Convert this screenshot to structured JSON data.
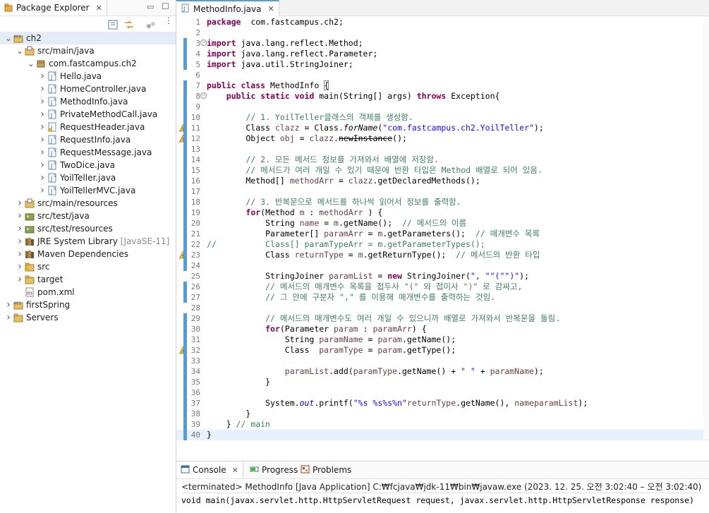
{
  "explorer": {
    "tab_label": "Package Explorer",
    "tree": [
      {
        "label": "ch2",
        "indent": 0,
        "twisty": "open",
        "icon": "maven-project-icon"
      },
      {
        "label": "src/main/java",
        "indent": 1,
        "twisty": "open",
        "icon": "source-folder-icon"
      },
      {
        "label": "com.fastcampus.ch2",
        "indent": 2,
        "twisty": "open",
        "icon": "package-icon"
      },
      {
        "label": "Hello.java",
        "indent": 3,
        "twisty": "closed",
        "icon": "java-file-icon"
      },
      {
        "label": "HomeController.java",
        "indent": 3,
        "twisty": "closed",
        "icon": "java-file-icon"
      },
      {
        "label": "MethodInfo.java",
        "indent": 3,
        "twisty": "closed",
        "icon": "java-file-icon"
      },
      {
        "label": "PrivateMethodCall.java",
        "indent": 3,
        "twisty": "closed",
        "icon": "java-file-icon"
      },
      {
        "label": "RequestHeader.java",
        "indent": 3,
        "twisty": "closed",
        "icon": "java-file-warn-icon"
      },
      {
        "label": "RequestInfo.java",
        "indent": 3,
        "twisty": "closed",
        "icon": "java-file-icon"
      },
      {
        "label": "RequestMessage.java",
        "indent": 3,
        "twisty": "closed",
        "icon": "java-file-icon"
      },
      {
        "label": "TwoDice.java",
        "indent": 3,
        "twisty": "closed",
        "icon": "java-file-icon"
      },
      {
        "label": "YoilTeller.java",
        "indent": 3,
        "twisty": "closed",
        "icon": "java-file-icon"
      },
      {
        "label": "YoilTellerMVC.java",
        "indent": 3,
        "twisty": "closed",
        "icon": "java-file-icon"
      },
      {
        "label": "src/main/resources",
        "indent": 1,
        "twisty": "closed",
        "icon": "source-folder-icon"
      },
      {
        "label": "src/test/java",
        "indent": 1,
        "twisty": "closed",
        "icon": "test-folder-icon"
      },
      {
        "label": "src/test/resources",
        "indent": 1,
        "twisty": "closed",
        "icon": "test-folder-icon"
      },
      {
        "label": "JRE System Library",
        "decoration": "[JavaSE-11]",
        "indent": 1,
        "twisty": "closed",
        "icon": "library-icon"
      },
      {
        "label": "Maven Dependencies",
        "indent": 1,
        "twisty": "closed",
        "icon": "library-icon"
      },
      {
        "label": "src",
        "indent": 1,
        "twisty": "closed",
        "icon": "folder-warn-icon"
      },
      {
        "label": "target",
        "indent": 1,
        "twisty": "closed",
        "icon": "folder-icon"
      },
      {
        "label": "pom.xml",
        "indent": 1,
        "twisty": "none",
        "icon": "maven-file-icon"
      },
      {
        "label": "firstSpring",
        "indent": 0,
        "twisty": "closed",
        "icon": "maven-project-icon"
      },
      {
        "label": "Servers",
        "indent": 0,
        "twisty": "closed",
        "icon": "folder-icon"
      }
    ]
  },
  "editor": {
    "tab_label": "MethodInfo.java",
    "lines": [
      {
        "n": "1",
        "tokens": [
          [
            "kw",
            "package"
          ],
          [
            "",
            "  com.fastcampus.ch2;"
          ]
        ]
      },
      {
        "n": "2",
        "tokens": []
      },
      {
        "n": "3",
        "fold": true,
        "tokens": [
          [
            "kw",
            "import"
          ],
          [
            "",
            " java.lang.reflect.Method;"
          ]
        ]
      },
      {
        "n": "4",
        "tokens": [
          [
            "kw",
            "import"
          ],
          [
            "",
            " java.lang.reflect.Parameter;"
          ]
        ]
      },
      {
        "n": "5",
        "tokens": [
          [
            "kw",
            "import"
          ],
          [
            "",
            " java.util.StringJoiner;"
          ]
        ]
      },
      {
        "n": "6",
        "tokens": []
      },
      {
        "n": "7",
        "tokens": [
          [
            "kw",
            "public class"
          ],
          [
            "",
            " MethodInfo "
          ],
          [
            "",
            "{"
          ]
        ]
      },
      {
        "n": "8",
        "fold": true,
        "tokens": [
          [
            "",
            "    "
          ],
          [
            "kw",
            "public static void"
          ],
          [
            "",
            " main(String[] args) "
          ],
          [
            "kw",
            "throws"
          ],
          [
            "",
            " Exception{"
          ]
        ]
      },
      {
        "n": "9",
        "tokens": []
      },
      {
        "n": "10",
        "tokens": [
          [
            "",
            "        "
          ],
          [
            "cmt",
            "// 1. YoilTeller클래스의 객체를 생성함."
          ]
        ]
      },
      {
        "n": "11",
        "warn": true,
        "tokens": [
          [
            "",
            "        Class "
          ],
          [
            "var",
            "clazz"
          ],
          [
            "",
            " = Class."
          ],
          [
            "it",
            "forName"
          ],
          [
            "",
            "("
          ],
          [
            "str",
            "\"com.fastcampus.ch2.YoilTeller\""
          ],
          [
            "",
            ");"
          ]
        ]
      },
      {
        "n": "12",
        "warn": true,
        "tokens": [
          [
            "",
            "        Object "
          ],
          [
            "var",
            "obj"
          ],
          [
            "",
            " = "
          ],
          [
            "var",
            "clazz"
          ],
          [
            "",
            "."
          ],
          [
            "strike",
            "newInstance"
          ],
          [
            "",
            "();"
          ]
        ]
      },
      {
        "n": "13",
        "tokens": []
      },
      {
        "n": "14",
        "tokens": [
          [
            "",
            "        "
          ],
          [
            "cmt",
            "// 2. 모든 메서드 정보를 가져와서 배열에 저장함."
          ]
        ]
      },
      {
        "n": "15",
        "tokens": [
          [
            "",
            "        "
          ],
          [
            "cmt",
            "// 메서드가 여러 개일 수 있기 때문에 반환 타입은 Method 배열로 되어 있음."
          ]
        ]
      },
      {
        "n": "16",
        "tokens": [
          [
            "",
            "        Method[] "
          ],
          [
            "var",
            "methodArr"
          ],
          [
            "",
            " = "
          ],
          [
            "var",
            "clazz"
          ],
          [
            "",
            ".getDeclaredMethods();"
          ]
        ]
      },
      {
        "n": "17",
        "tokens": []
      },
      {
        "n": "18",
        "tokens": [
          [
            "",
            "        "
          ],
          [
            "cmt",
            "// 3. 반복문으로 메서드를 하나씩 읽어서 정보를 출력함."
          ]
        ]
      },
      {
        "n": "19",
        "tokens": [
          [
            "",
            "        "
          ],
          [
            "kw",
            "for"
          ],
          [
            "",
            "(Method "
          ],
          [
            "var",
            "m"
          ],
          [
            "",
            " : "
          ],
          [
            "var",
            "methodArr"
          ],
          [
            "",
            " ) {"
          ]
        ]
      },
      {
        "n": "20",
        "tokens": [
          [
            "",
            "            String "
          ],
          [
            "var",
            "name"
          ],
          [
            "",
            " = "
          ],
          [
            "var",
            "m"
          ],
          [
            "",
            ".getName();  "
          ],
          [
            "cmt",
            "// 메서드의 이름"
          ]
        ]
      },
      {
        "n": "21",
        "tokens": [
          [
            "",
            "            Parameter[] "
          ],
          [
            "var",
            "paramArr"
          ],
          [
            "",
            " = "
          ],
          [
            "var",
            "m"
          ],
          [
            "",
            ".getParameters();  "
          ],
          [
            "cmt",
            "// 매개변수 목록"
          ]
        ]
      },
      {
        "n": "22",
        "tokens": [
          [
            "cmt",
            "//          Class[] paramTypeArr = m.getParameterTypes();"
          ]
        ]
      },
      {
        "n": "23",
        "warn": true,
        "tokens": [
          [
            "",
            "            Class "
          ],
          [
            "var",
            "returnType"
          ],
          [
            "",
            " = "
          ],
          [
            "var",
            "m"
          ],
          [
            "",
            ".getReturnType();  "
          ],
          [
            "cmt",
            "// 메서드의 반환 타입"
          ]
        ]
      },
      {
        "n": "24",
        "tokens": []
      },
      {
        "n": "25",
        "tokens": [
          [
            "",
            "            StringJoiner "
          ],
          [
            "var",
            "paramList"
          ],
          [
            "",
            " = "
          ],
          [
            "kw",
            "new"
          ],
          [
            "",
            " StringJoiner("
          ],
          [
            "str",
            "\", \""
          ],
          [
            ", "
          ],
          [
            "str",
            "\"(\""
          ],
          [
            ", "
          ],
          [
            "str",
            "\")\""
          ],
          [
            "",
            ");"
          ]
        ]
      },
      {
        "n": "26",
        "tokens": [
          [
            "",
            "            "
          ],
          [
            "cmt",
            "// 메서드의 매개변수 목록을 접두사 \"(\" 와 접미사 \")\" 로 감싸고,"
          ]
        ]
      },
      {
        "n": "27",
        "tokens": [
          [
            "",
            "            "
          ],
          [
            "cmt",
            "// 그 안에 구분자 \",\" 를 이용해 매개변수를 출력하는 것임."
          ]
        ]
      },
      {
        "n": "28",
        "tokens": []
      },
      {
        "n": "29",
        "tokens": [
          [
            "",
            "            "
          ],
          [
            "cmt",
            "// 메서드의 매개변수도 여러 개일 수 있으니까 배열로 가져와서 반복문을 돌림."
          ]
        ]
      },
      {
        "n": "30",
        "tokens": [
          [
            "",
            "            "
          ],
          [
            "kw",
            "for"
          ],
          [
            "",
            "(Parameter "
          ],
          [
            "var",
            "param"
          ],
          [
            "",
            " : "
          ],
          [
            "var",
            "paramArr"
          ],
          [
            "",
            ") {"
          ]
        ]
      },
      {
        "n": "31",
        "tokens": [
          [
            "",
            "                String "
          ],
          [
            "var",
            "paramName"
          ],
          [
            "",
            " = "
          ],
          [
            "var",
            "param"
          ],
          [
            "",
            ".getName();"
          ]
        ]
      },
      {
        "n": "32",
        "warn": true,
        "tokens": [
          [
            "",
            "                Class  "
          ],
          [
            "var",
            "paramType"
          ],
          [
            "",
            " = "
          ],
          [
            "var",
            "param"
          ],
          [
            "",
            ".getType();"
          ]
        ]
      },
      {
        "n": "33",
        "tokens": []
      },
      {
        "n": "34",
        "tokens": [
          [
            "",
            "                "
          ],
          [
            "var",
            "paramList"
          ],
          [
            "",
            ".add("
          ],
          [
            "var",
            "paramType"
          ],
          [
            "",
            ".getName() + "
          ],
          [
            "str",
            "\" \""
          ],
          [
            "",
            " + "
          ],
          [
            "var",
            "paramName"
          ],
          [
            "",
            ");"
          ]
        ]
      },
      {
        "n": "35",
        "tokens": [
          [
            "",
            "            }"
          ]
        ]
      },
      {
        "n": "36",
        "tokens": []
      },
      {
        "n": "37",
        "tokens": [
          [
            "",
            "            System."
          ],
          [
            "fld",
            "out"
          ],
          [
            "",
            ".printf("
          ],
          [
            "str",
            "\"%s %s%s%n\""
          ],
          [
            ", "
          ],
          [
            "var",
            "returnType"
          ],
          [
            "",
            ".getName(), "
          ],
          [
            "var",
            "name"
          ],
          [
            ", "
          ],
          [
            "var",
            "paramList"
          ],
          [
            "",
            ");"
          ]
        ]
      },
      {
        "n": "38",
        "tokens": [
          [
            "",
            "        }"
          ]
        ]
      },
      {
        "n": "39",
        "tokens": [
          [
            "",
            "    } "
          ],
          [
            "cmt",
            "// main"
          ]
        ]
      },
      {
        "n": "40",
        "current": true,
        "tokens": [
          [
            "",
            "}"
          ]
        ]
      }
    ]
  },
  "console": {
    "tabs": [
      {
        "label": "Console",
        "icon": "console-icon"
      },
      {
        "label": "Progress",
        "icon": "progress-icon"
      },
      {
        "label": "Problems",
        "icon": "problems-icon"
      }
    ],
    "status": "<terminated> MethodInfo [Java Application] C:₩fcjava₩jdk-11₩bin₩javaw.exe  (2023. 12. 25. 오전 3:02:40 – 오전 3:02:40)",
    "output": "void main(javax.servlet.http.HttpServletRequest request, javax.servlet.http.HttpServletResponse response)"
  },
  "colors": {
    "accent": "#5c9bd1",
    "keyword": "#7f0055",
    "string": "#2a00ff",
    "comment": "#3f7f5f",
    "variable": "#6a3e3e"
  }
}
